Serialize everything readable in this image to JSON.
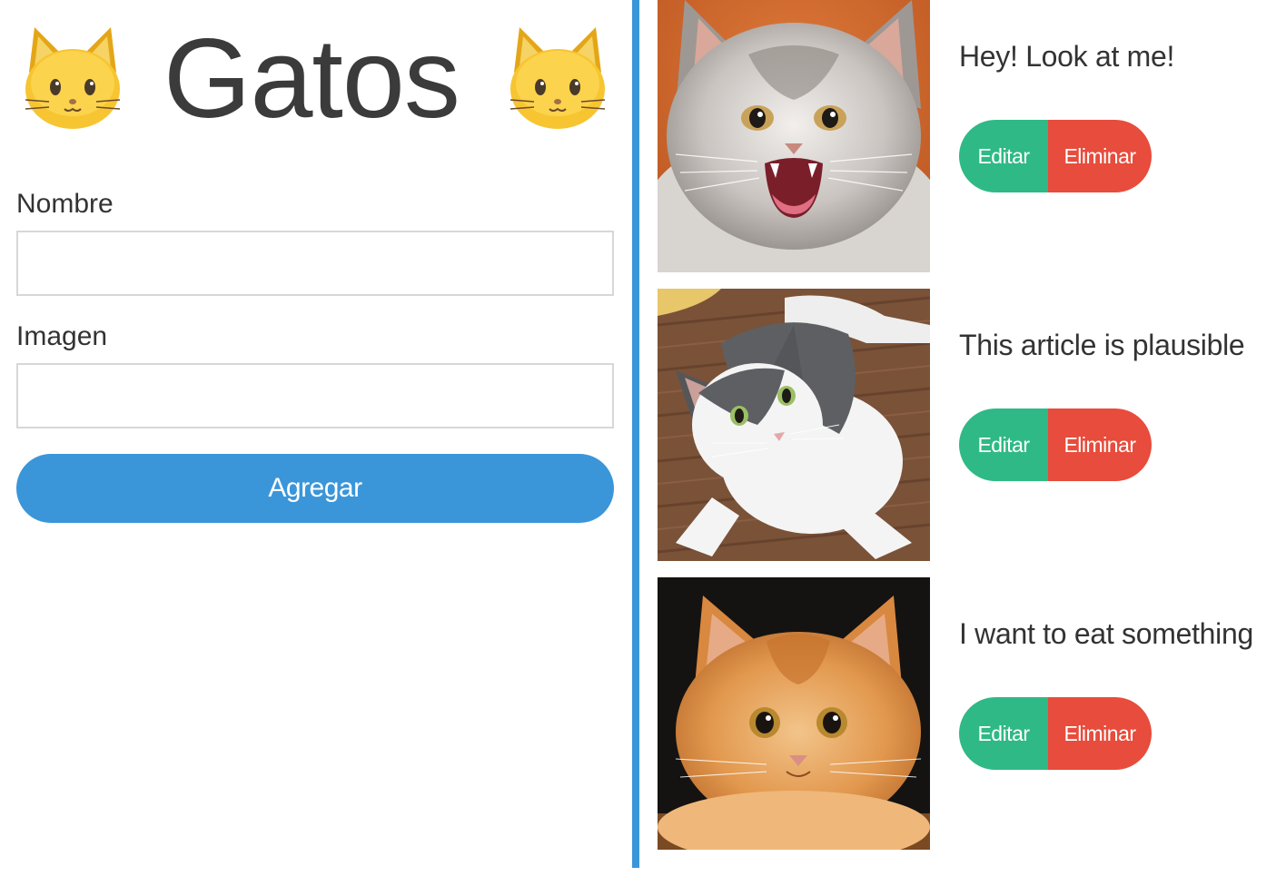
{
  "header": {
    "title": "Gatos",
    "emoji": "cat-face"
  },
  "form": {
    "name_label": "Nombre",
    "name_value": "",
    "image_label": "Imagen",
    "image_value": "",
    "submit_label": "Agregar"
  },
  "cats": [
    {
      "name": "Hey! Look at me!",
      "edit_label": "Editar",
      "delete_label": "Eliminar",
      "photo": "grey fluffy kitten meowing on orange background"
    },
    {
      "name": "This article is plausible",
      "edit_label": "Editar",
      "delete_label": "Eliminar",
      "photo": "grey and white cat lying on wooden floor"
    },
    {
      "name": "I want to eat something",
      "edit_label": "Editar",
      "delete_label": "Eliminar",
      "photo": "orange kitten lying on dark background"
    }
  ],
  "colors": {
    "accent": "#3a96d9",
    "edit": "#2fb986",
    "delete": "#e74c3c"
  }
}
